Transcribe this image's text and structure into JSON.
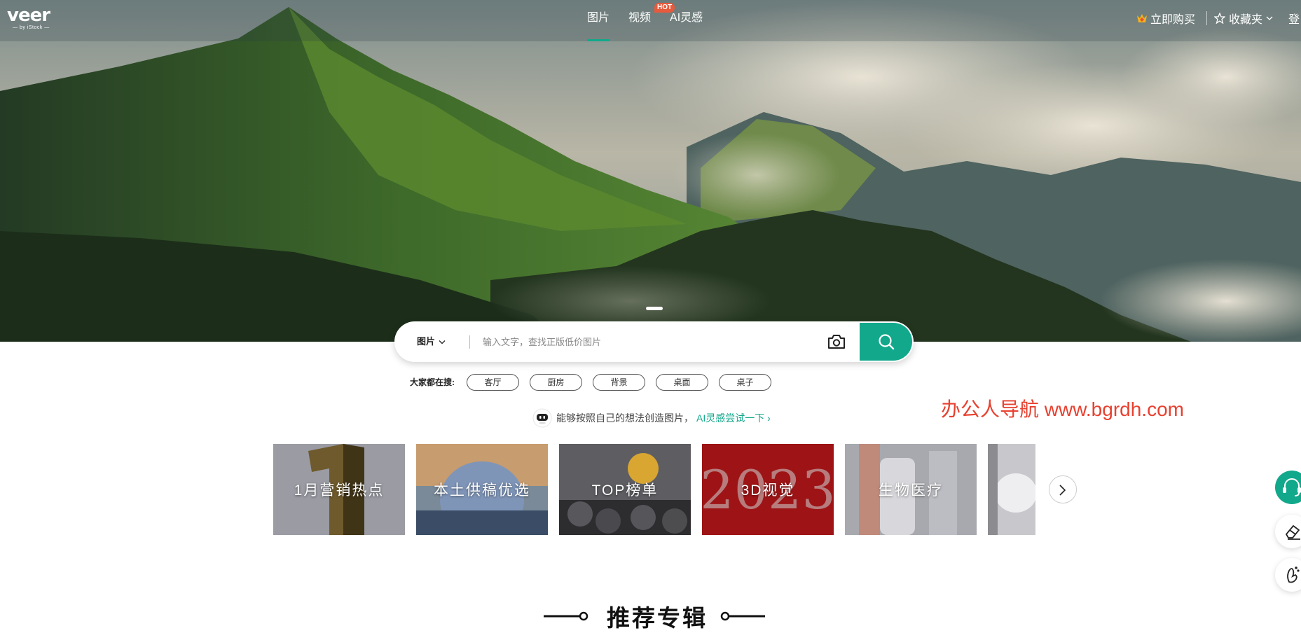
{
  "header": {
    "logo_text": "veer",
    "logo_sub": "— by iStock —",
    "nav": [
      {
        "label": "图片",
        "active": true
      },
      {
        "label": "视频",
        "badge": "HOT"
      },
      {
        "label": "AI灵感"
      }
    ],
    "buy_label": "立即购买",
    "favorites_label": "收藏夹",
    "login_label": "登"
  },
  "search": {
    "type_label": "图片",
    "placeholder": "输入文字，查找正版低价图片"
  },
  "hot_search": {
    "label": "大家都在搜:",
    "tags": [
      "客厅",
      "厨房",
      "背景",
      "桌面",
      "桌子"
    ]
  },
  "ai_promo": {
    "text": "能够按照自己的想法创造图片，",
    "link": "AI灵感尝试一下"
  },
  "watermark": "办公人导航 www.bgrdh.com",
  "categories": [
    {
      "label": "1月营销热点"
    },
    {
      "label": "本土供稿优选"
    },
    {
      "label": "TOP榜单"
    },
    {
      "label": "3D视觉"
    },
    {
      "label": "生物医疗"
    },
    {
      "label": ""
    }
  ],
  "section_title": "推荐专辑",
  "colors": {
    "accent": "#12a88b",
    "hot_badge": "#e85a3c",
    "watermark": "#e8402f"
  }
}
